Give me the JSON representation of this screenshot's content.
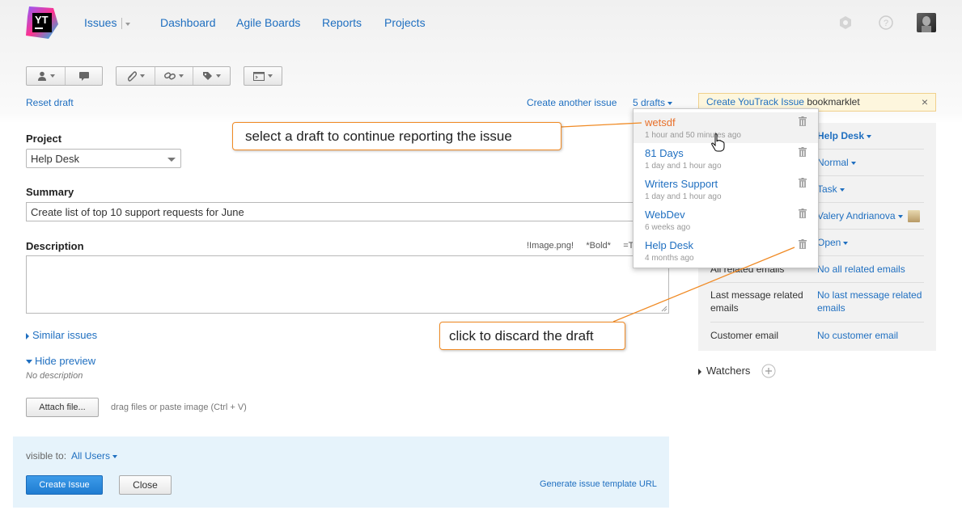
{
  "header": {
    "logo_text": "YT",
    "nav": {
      "issues": "Issues",
      "dashboard": "Dashboard",
      "agile_boards": "Agile Boards",
      "reports": "Reports",
      "projects": "Projects"
    },
    "icons": [
      "settings-icon",
      "help-icon",
      "avatar"
    ]
  },
  "toolbar": {
    "groups": [
      [
        "assignee-icon",
        "comment-icon"
      ],
      [
        "attachment-icon",
        "link-icon",
        "tag-icon"
      ],
      [
        "command-icon"
      ]
    ]
  },
  "links": {
    "reset_draft": "Reset draft",
    "create_another": "Create another issue",
    "drafts_count": "5 drafts"
  },
  "bookmarklet": {
    "link": "Create YouTrack Issue",
    "text": "bookmarklet",
    "close": "×"
  },
  "form": {
    "project_label": "Project",
    "project_value": "Help Desk",
    "summary_label": "Summary",
    "summary_value": "Create list of top 10 support requests for June",
    "description_label": "Description",
    "hint_image": "!Image.png!",
    "hint_bold": "*Bold*",
    "hint_title": "=Title",
    "similar_issues": "Similar issues",
    "hide_preview": "Hide preview",
    "no_description": "No description",
    "attach_button": "Attach file...",
    "attach_hint": "drag files or paste image (Ctrl + V)"
  },
  "footer": {
    "visible_to_label": "visible to:",
    "visible_to_value": "All Users",
    "create_button": "Create Issue",
    "close_button": "Close",
    "template_link": "Generate issue template URL"
  },
  "fields": {
    "project": "Help Desk",
    "priority": "Normal",
    "type": "Task",
    "assignee": "Valery Andrianova",
    "state": "Open",
    "all_related_key": "All related emails",
    "all_related_val": "No all related emails",
    "last_message_key": "Last message related emails",
    "last_message_val": "No last message related emails",
    "customer_key": "Customer email",
    "customer_val": "No customer email"
  },
  "watchers": "Watchers",
  "drafts": [
    {
      "name": "wetsdf",
      "time": "1 hour and 50 minutes ago"
    },
    {
      "name": "81 Days",
      "time": "1 day and 1 hour ago"
    },
    {
      "name": "Writers Support",
      "time": "1 day and 1 hour ago"
    },
    {
      "name": "WebDev",
      "time": "6 weeks ago"
    },
    {
      "name": "Help Desk",
      "time": "4 months ago"
    }
  ],
  "callouts": {
    "select": "select a draft to continue reporting the issue",
    "discard": "click to discard the draft"
  },
  "colors": {
    "link": "#1f6fc0",
    "active_draft": "#e8702a",
    "callout_border": "#f08a24",
    "primary_button": "#2a88dc"
  }
}
